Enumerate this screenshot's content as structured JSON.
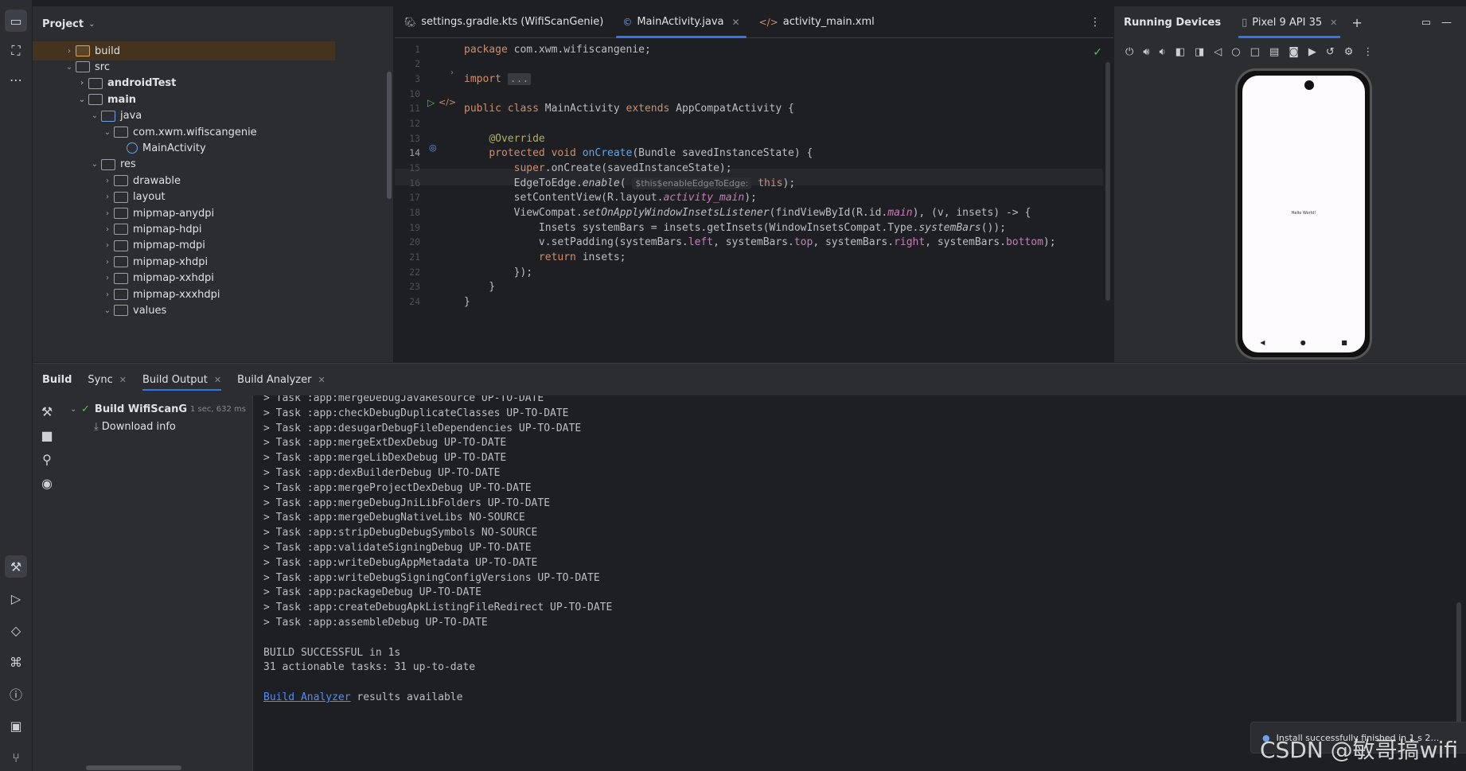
{
  "project_panel": {
    "title": "Project",
    "tree": [
      {
        "label": "build",
        "indent": 0,
        "chev": "›",
        "icon": "folder-orange"
      },
      {
        "label": "src",
        "indent": 0,
        "chev": "⌄",
        "icon": "folder"
      },
      {
        "label": "androidTest",
        "indent": 1,
        "chev": "›",
        "icon": "folder",
        "bold": true
      },
      {
        "label": "main",
        "indent": 1,
        "chev": "⌄",
        "icon": "folder",
        "bold": true
      },
      {
        "label": "java",
        "indent": 2,
        "chev": "⌄",
        "icon": "folder-blue"
      },
      {
        "label": "com.xwm.wifiscangenie",
        "indent": 3,
        "chev": "⌄",
        "icon": "folder"
      },
      {
        "label": "MainActivity",
        "indent": 4,
        "chev": "",
        "icon": "class"
      },
      {
        "label": "res",
        "indent": 2,
        "chev": "⌄",
        "icon": "folder"
      },
      {
        "label": "drawable",
        "indent": 3,
        "chev": "›",
        "icon": "folder"
      },
      {
        "label": "layout",
        "indent": 3,
        "chev": "›",
        "icon": "folder"
      },
      {
        "label": "mipmap-anydpi",
        "indent": 3,
        "chev": "›",
        "icon": "folder"
      },
      {
        "label": "mipmap-hdpi",
        "indent": 3,
        "chev": "›",
        "icon": "folder"
      },
      {
        "label": "mipmap-mdpi",
        "indent": 3,
        "chev": "›",
        "icon": "folder"
      },
      {
        "label": "mipmap-xhdpi",
        "indent": 3,
        "chev": "›",
        "icon": "folder"
      },
      {
        "label": "mipmap-xxhdpi",
        "indent": 3,
        "chev": "›",
        "icon": "folder"
      },
      {
        "label": "mipmap-xxxhdpi",
        "indent": 3,
        "chev": "›",
        "icon": "folder"
      },
      {
        "label": "values",
        "indent": 3,
        "chev": "⌄",
        "icon": "folder"
      }
    ]
  },
  "editor": {
    "tabs": [
      {
        "label": "settings.gradle.kts (WifiScanGenie)",
        "icon": "gradle-icon",
        "closable": false
      },
      {
        "label": "MainActivity.java",
        "icon": "class-icon",
        "closable": true,
        "active": true
      },
      {
        "label": "activity_main.xml",
        "icon": "xml-icon",
        "closable": false
      }
    ],
    "line_numbers": [
      "1",
      "2",
      "3",
      "10",
      "11",
      "12",
      "13",
      "14",
      "15",
      "16",
      "17",
      "18",
      "19",
      "20",
      "21",
      "22",
      "23",
      "24"
    ],
    "current_line": "14",
    "hint_text": "$this$enableEdgeToEdge:",
    "fold_text": "..."
  },
  "devices": {
    "title": "Running Devices",
    "device_tab": "Pixel 9 API 35",
    "screen_text": "Hello World!"
  },
  "build": {
    "tabs": [
      {
        "label": "Build",
        "closable": false,
        "bold": true
      },
      {
        "label": "Sync",
        "closable": true
      },
      {
        "label": "Build Output",
        "closable": true
      },
      {
        "label": "Build Analyzer",
        "closable": true
      }
    ],
    "tree_root": "Build WifiScanG",
    "tree_root_time": "1 sec, 632 ms",
    "tree_child": "Download info",
    "output_lines": [
      "> Task :app:mergeDebugJavaResource UP-TO-DATE",
      "> Task :app:checkDebugDuplicateClasses UP-TO-DATE",
      "> Task :app:desugarDebugFileDependencies UP-TO-DATE",
      "> Task :app:mergeExtDexDebug UP-TO-DATE",
      "> Task :app:mergeLibDexDebug UP-TO-DATE",
      "> Task :app:dexBuilderDebug UP-TO-DATE",
      "> Task :app:mergeProjectDexDebug UP-TO-DATE",
      "> Task :app:mergeDebugJniLibFolders UP-TO-DATE",
      "> Task :app:mergeDebugNativeLibs NO-SOURCE",
      "> Task :app:stripDebugDebugSymbols NO-SOURCE",
      "> Task :app:validateSigningDebug UP-TO-DATE",
      "> Task :app:writeDebugAppMetadata UP-TO-DATE",
      "> Task :app:writeDebugSigningConfigVersions UP-TO-DATE",
      "> Task :app:packageDebug UP-TO-DATE",
      "> Task :app:createDebugApkListingFileRedirect UP-TO-DATE",
      "> Task :app:assembleDebug UP-TO-DATE",
      "",
      "BUILD SUCCESSFUL in 1s",
      "31 actionable tasks: 31 up-to-date"
    ],
    "analyzer_link": "Build Analyzer",
    "analyzer_suffix": " results available",
    "notification": "Install successfully finished in 1 s 2…",
    "watermark": "CSDN @敏哥搞wifi"
  }
}
